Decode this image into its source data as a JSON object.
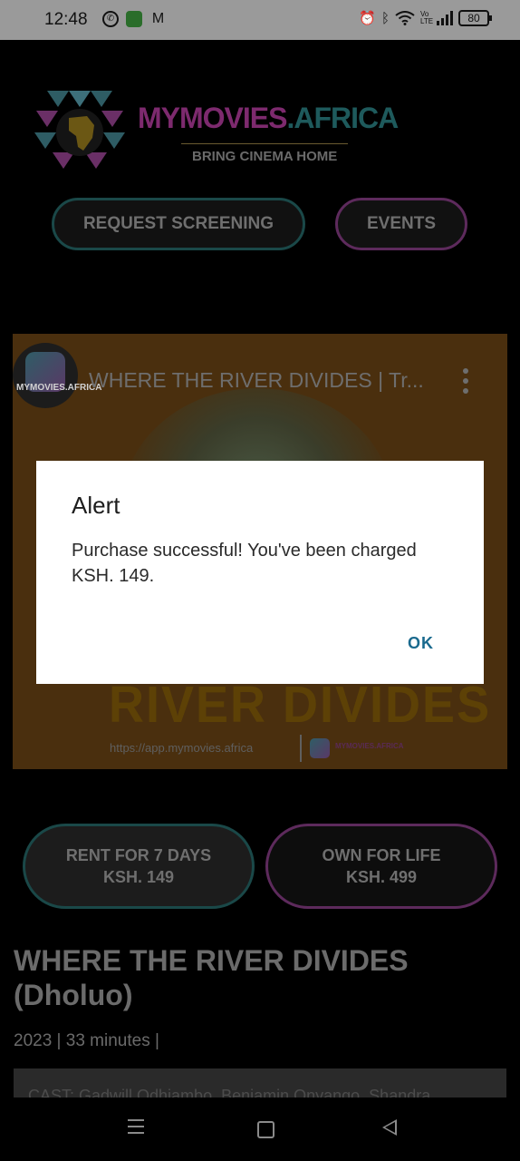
{
  "status_bar": {
    "time": "12:48",
    "left_icons": [
      "whatsapp-icon",
      "chat-icon",
      "gmail-icon"
    ],
    "right_icons": [
      "alarm-icon",
      "bluetooth-icon",
      "wifi-icon",
      "volte-icon",
      "signal-icon"
    ],
    "volte_text": "Vo LTE",
    "battery": "80"
  },
  "header": {
    "brand_main": "MYMOVIES",
    "brand_suffix": ".AFRICA",
    "tagline": "BRING CINEMA HOME",
    "buttons": {
      "request_screening": "REQUEST SCREENING",
      "events": "EVENTS"
    }
  },
  "video": {
    "channel_label": "MYMOVIES.AFRICA",
    "title": "WHERE THE RIVER DIVIDES | Tr...",
    "overlay_text": "RIVER DIVIDES",
    "url": "https://app.mymovies.africa",
    "mini_brand": "MYMOVIES.AFRICA"
  },
  "purchase": {
    "rent_line1": "RENT FOR 7 DAYS",
    "rent_line2": "KSH. 149",
    "own_line1": "OWN FOR LIFE",
    "own_line2": "KSH. 499"
  },
  "movie": {
    "title": "WHERE THE RIVER DIVIDES (Dholuo)",
    "meta": "2023 | 33 minutes |",
    "cast": "CAST:  Gadwill Odhiambo, Benjamin Onyango, Shandra"
  },
  "dialog": {
    "title": "Alert",
    "message": "Purchase successful! You've been charged KSH. 149.",
    "ok_label": "OK"
  },
  "colors": {
    "brand_purple": "#7d2a6e",
    "brand_teal": "#1e5a5c",
    "dialog_button": "#1a6a8e"
  }
}
